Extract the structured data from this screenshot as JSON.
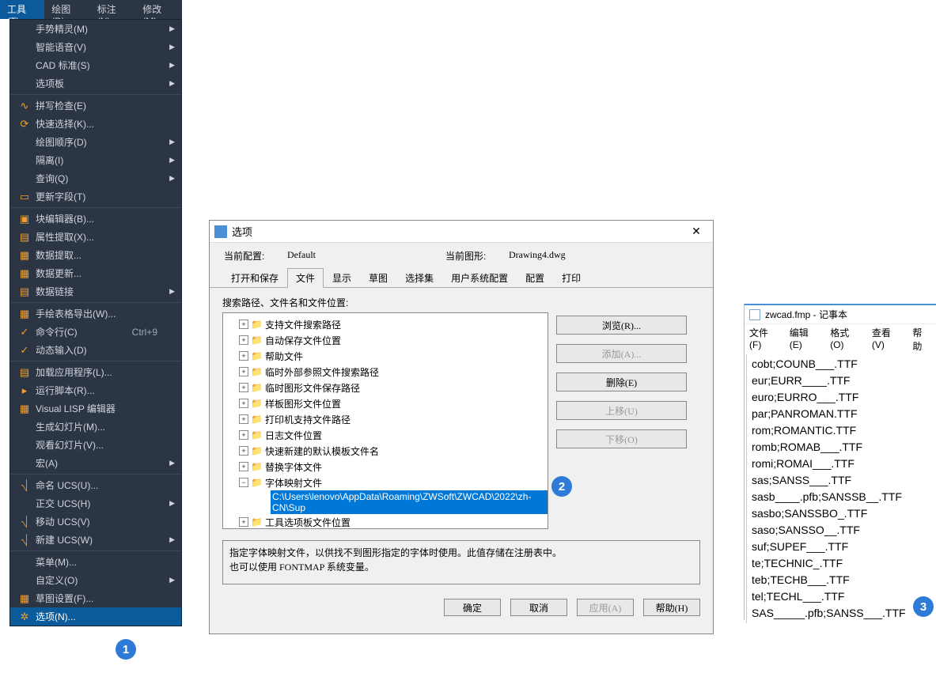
{
  "menubar": [
    "工具(T)",
    "绘图(D)",
    "标注(N)",
    "修改(M)"
  ],
  "menu": {
    "items": [
      {
        "label": "手势精灵(M)",
        "arrow": true
      },
      {
        "label": "智能语音(V)",
        "arrow": true
      },
      {
        "label": "CAD 标准(S)",
        "arrow": true
      },
      {
        "label": "选项板",
        "arrow": true,
        "sep_after": true
      },
      {
        "label": "拼写检查(E)",
        "icon": "∿"
      },
      {
        "label": "快速选择(K)...",
        "icon": "⟳"
      },
      {
        "label": "绘图顺序(D)",
        "arrow": true
      },
      {
        "label": "隔离(I)",
        "arrow": true
      },
      {
        "label": "查询(Q)",
        "arrow": true
      },
      {
        "label": "更新字段(T)",
        "icon": "▭",
        "sep_after": true
      },
      {
        "label": "块编辑器(B)...",
        "icon": "▣"
      },
      {
        "label": "属性提取(X)...",
        "icon": "▤"
      },
      {
        "label": "数据提取...",
        "icon": "▦"
      },
      {
        "label": "数据更新...",
        "icon": "▦"
      },
      {
        "label": "数据链接",
        "icon": "▤",
        "arrow": true,
        "sep_after": true
      },
      {
        "label": "手绘表格导出(W)...",
        "icon": "▦"
      },
      {
        "label": "命令行(C)",
        "icon": "✓",
        "shortcut": "Ctrl+9"
      },
      {
        "label": "动态输入(D)",
        "icon": "✓",
        "sep_after": true
      },
      {
        "label": "加载应用程序(L)...",
        "icon": "▤"
      },
      {
        "label": "运行脚本(R)...",
        "icon": "▸"
      },
      {
        "label": "Visual LISP 编辑器",
        "icon": "▦"
      },
      {
        "label": "生成幻灯片(M)..."
      },
      {
        "label": "观看幻灯片(V)..."
      },
      {
        "label": "宏(A)",
        "arrow": true,
        "sep_after": true
      },
      {
        "label": "命名 UCS(U)...",
        "icon": "⎷"
      },
      {
        "label": "正交 UCS(H)",
        "arrow": true
      },
      {
        "label": "移动 UCS(V)",
        "icon": "⎷"
      },
      {
        "label": "新建 UCS(W)",
        "icon": "⎷",
        "arrow": true,
        "sep_after": true
      },
      {
        "label": "菜单(M)..."
      },
      {
        "label": "自定义(O)",
        "arrow": true
      },
      {
        "label": "草图设置(F)...",
        "icon": "▦"
      },
      {
        "label": "选项(N)...",
        "icon": "✲",
        "active": true
      }
    ]
  },
  "dialog": {
    "title": "选项",
    "info": {
      "cur_profile_label": "当前配置:",
      "cur_profile_val": "Default",
      "cur_drawing_label": "当前图形:",
      "cur_drawing_val": "Drawing4.dwg"
    },
    "tabs": [
      "打开和保存",
      "文件",
      "显示",
      "草图",
      "选择集",
      "用户系统配置",
      "配置",
      "打印"
    ],
    "section_label": "搜索路径、文件名和文件位置:",
    "tree": [
      "支持文件搜索路径",
      "自动保存文件位置",
      "帮助文件",
      "临时外部参照文件搜索路径",
      "临时图形文件保存路径",
      "样板图形文件位置",
      "打印机支持文件路径",
      "日志文件位置",
      "快速新建的默认模板文件名",
      "替换字体文件"
    ],
    "tree_open": "字体映射文件",
    "tree_selected": "C:\\Users\\lenovo\\AppData\\Roaming\\ZWSoft\\ZWCAD\\2022\\zh-CN\\Sup",
    "tree_after": "工具选项板文件位置",
    "buttons": {
      "browse": "浏览(R)...",
      "add": "添加(A)...",
      "delete": "删除(E)",
      "moveup": "上移(U)",
      "movedown": "下移(O)"
    },
    "desc": "指定字体映射文件，以供找不到图形指定的字体时使用。此值存储在注册表中。\n也可以使用 FONTMAP 系统变量。",
    "footer": {
      "ok": "确定",
      "cancel": "取消",
      "apply": "应用(A)",
      "help": "帮助(H)"
    }
  },
  "notepad": {
    "title": "zwcad.fmp - 记事本",
    "menu": [
      "文件(F)",
      "编辑(E)",
      "格式(O)",
      "查看(V)",
      "帮助"
    ],
    "lines": [
      "cobt;COUNB___.TTF",
      "eur;EURR____.TTF",
      "euro;EURRO___.TTF",
      "par;PANROMAN.TTF",
      "rom;ROMANTIC.TTF",
      "romb;ROMAB___.TTF",
      "romi;ROMAI___.TTF",
      "sas;SANSS___.TTF",
      "sasb____.pfb;SANSSB__.TTF",
      "sasbo;SANSSBO_.TTF",
      "saso;SANSSO__.TTF",
      "suf;SUPEF___.TTF",
      "te;TECHNIC_.TTF",
      "teb;TECHB___.TTF",
      "tel;TECHL___.TTF",
      "SAS_____.pfb;SANSS___.TTF"
    ]
  },
  "badges": {
    "b1": "1",
    "b2": "2",
    "b3": "3"
  }
}
